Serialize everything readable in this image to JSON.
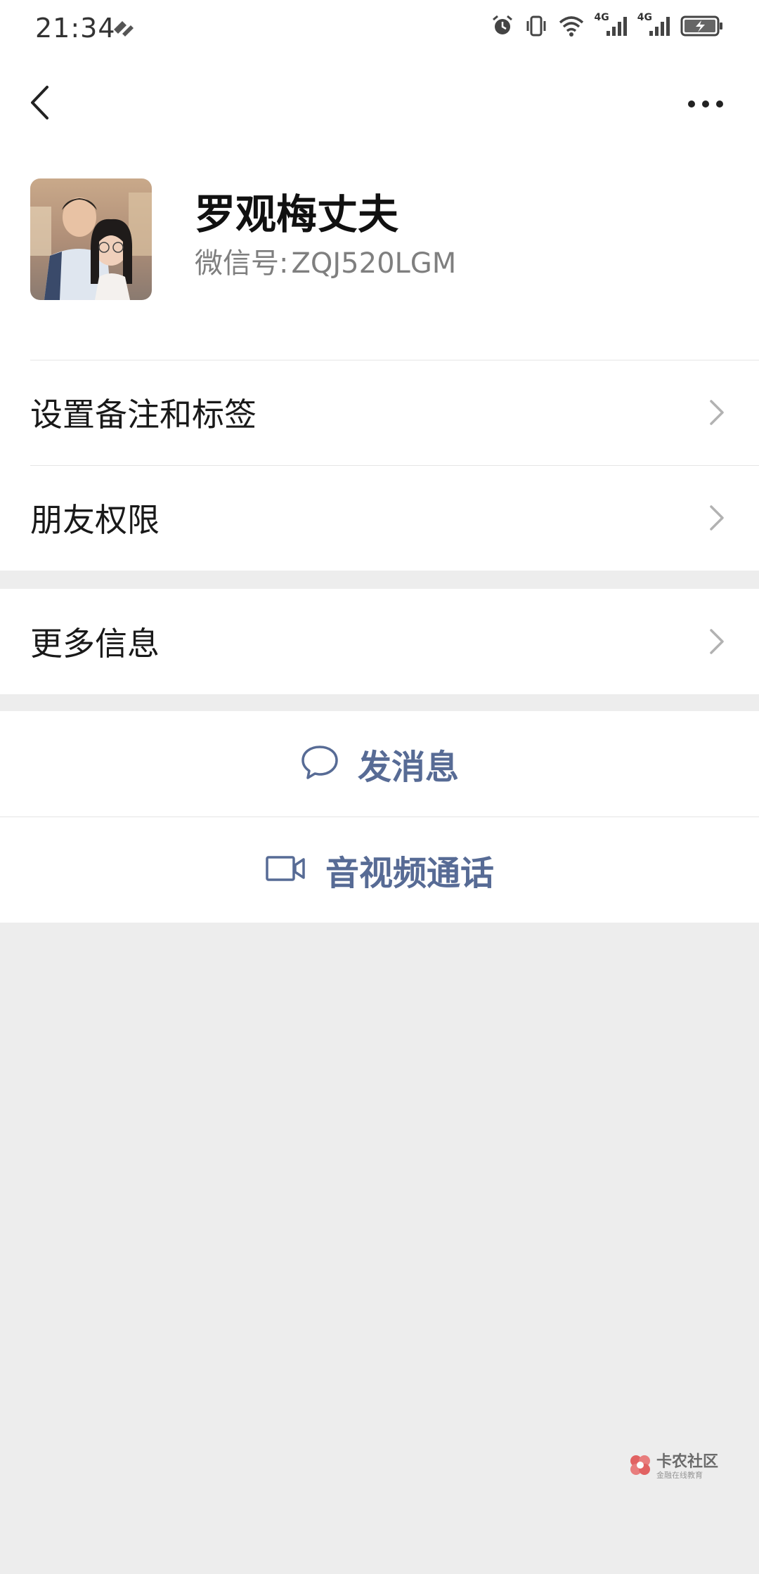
{
  "status_bar": {
    "time": "21:34",
    "icons": [
      "alarm-icon",
      "vibrate-icon",
      "wifi-icon",
      "cellular-signal-icon",
      "cellular-signal-icon",
      "battery-charging-icon"
    ],
    "network_labels": [
      "4G",
      "4G"
    ]
  },
  "header": {
    "back_icon": "chevron-left-icon",
    "more_icon": "more-dots-icon"
  },
  "profile": {
    "name": "罗观梅丈夫",
    "wechat_id_label": "微信号:",
    "wechat_id": "ZQJ520LGM"
  },
  "menu": {
    "items": [
      {
        "label": "设置备注和标签"
      },
      {
        "label": "朋友权限"
      },
      {
        "label": "更多信息"
      }
    ]
  },
  "actions": {
    "message_label": "发消息",
    "video_call_label": "音视频通话"
  },
  "watermark": {
    "title": "卡农社区",
    "subtitle": "金融在线教育"
  },
  "colors": {
    "background": "#ededed",
    "card": "#ffffff",
    "link": "#576b95",
    "text": "#191919",
    "secondary_text": "#7f7f7f"
  }
}
